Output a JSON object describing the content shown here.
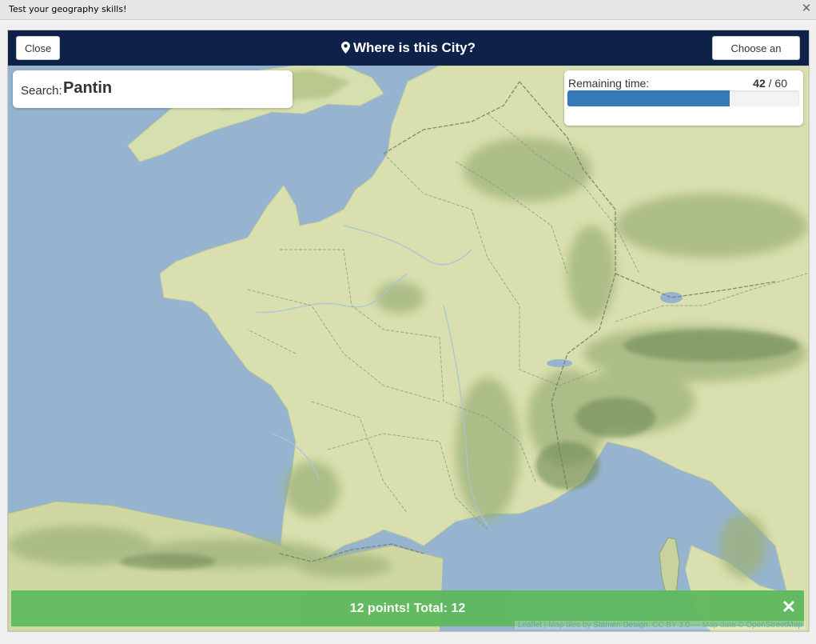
{
  "window": {
    "title": "Test your geography skills!",
    "close_icon": "close-icon"
  },
  "header": {
    "close_label": "Close",
    "title": "Where is this City?",
    "title_icon": "map-marker-icon",
    "choose_area_label": "Choose an area",
    "background": "#0e2148"
  },
  "search": {
    "label": "Search:",
    "city": "Pantin"
  },
  "timer": {
    "label": "Remaining time:",
    "remaining": "42",
    "separator": "/",
    "total": "60",
    "progress_fraction": 0.7,
    "bar_color": "#337ab7"
  },
  "result": {
    "message": "12 points!  Total: 12",
    "close_icon": "close-icon",
    "color": "#5cb85c"
  },
  "attribution": {
    "leaflet": "Leaflet",
    "sep": " | Map tiles by ",
    "stamen": "Stamen Design",
    "cc": ", CC BY 3.0",
    "data": " — Map data © ",
    "osm": "OpenStreetMap"
  }
}
